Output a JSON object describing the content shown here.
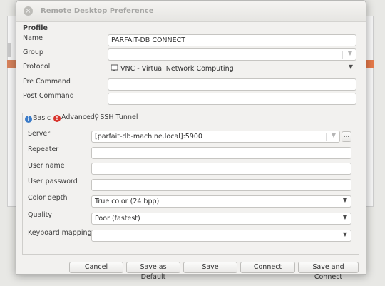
{
  "window": {
    "title": "Remote Desktop Preference",
    "close_glyph": "×"
  },
  "profile": {
    "section_title": "Profile",
    "name_label": "Name",
    "name_value": "PARFAIT-DB CONNECT",
    "group_label": "Group",
    "group_value": "",
    "protocol_label": "Protocol",
    "protocol_value": "VNC - Virtual Network Computing",
    "pre_command_label": "Pre Command",
    "pre_command_value": "",
    "post_command_label": "Post Command",
    "post_command_value": ""
  },
  "tabs": [
    {
      "label": "Basic",
      "icon": "info-icon",
      "active": true
    },
    {
      "label": "Advanced",
      "icon": "alert-icon",
      "active": false
    },
    {
      "label": "SSH Tunnel",
      "icon": "search-icon",
      "active": false
    }
  ],
  "basic": {
    "server_label": "Server",
    "server_value": "[parfait-db-machine.local]:5900",
    "browse_label": "...",
    "repeater_label": "Repeater",
    "repeater_value": "",
    "username_label": "User name",
    "username_value": "",
    "password_label": "User password",
    "password_value": "",
    "color_depth_label": "Color depth",
    "color_depth_value": "True color (24 bpp)",
    "quality_label": "Quality",
    "quality_value": "Poor (fastest)",
    "keyboard_label": "Keyboard mapping",
    "keyboard_value": ""
  },
  "buttons": {
    "cancel": "Cancel",
    "save_default": "Save as Default",
    "save": "Save",
    "connect": "Connect",
    "save_connect": "Save and Connect"
  },
  "icons": {
    "combo_arrow": "▼",
    "protocol_icon": "monitor-icon"
  },
  "colors": {
    "accent_orange": "#e77a4a",
    "info_blue": "#3b7bc8",
    "alert_red": "#d8342c"
  }
}
